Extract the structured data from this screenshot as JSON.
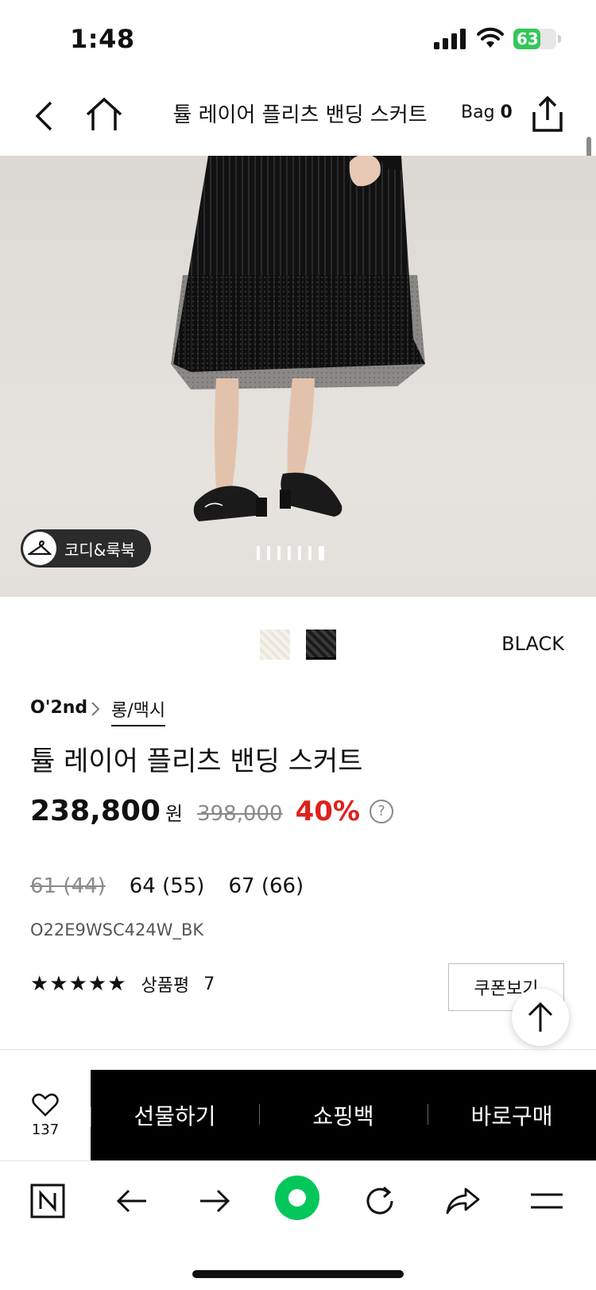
{
  "status": {
    "time": "1:48",
    "battery": "63"
  },
  "header": {
    "title": "튤 레이어 플리츠 밴딩 스커트",
    "bag_label": "Bag",
    "bag_count": "0"
  },
  "hero": {
    "look_button": "코디&룩북",
    "image_count": 7,
    "active_index": 6
  },
  "colors": {
    "selected": "BLACK",
    "swatches": [
      "ivory",
      "black"
    ]
  },
  "product": {
    "brand": "O'2nd",
    "category": "롱/맥시",
    "name": "튤 레이어 플리츠 밴딩 스커트",
    "price": "238,800",
    "currency": "원",
    "original_price": "398,000",
    "discount": "40%",
    "help": "?",
    "sizes": [
      {
        "label": "61 (44)",
        "soldout": true
      },
      {
        "label": "64 (55)",
        "soldout": false
      },
      {
        "label": "67 (66)",
        "soldout": false
      }
    ],
    "sku": "O22E9WSC424W_BK",
    "stars": "★★★★★",
    "review_label": "상품평",
    "review_count": "7",
    "coupon_button": "쿠폰보기"
  },
  "actions": {
    "wish_count": "137",
    "gift": "선물하기",
    "cart": "쇼핑백",
    "buy": "바로구매"
  },
  "colors_theme": {
    "discount": "#e0201c",
    "battery": "#34c759",
    "naver_green": "#03c75a"
  }
}
